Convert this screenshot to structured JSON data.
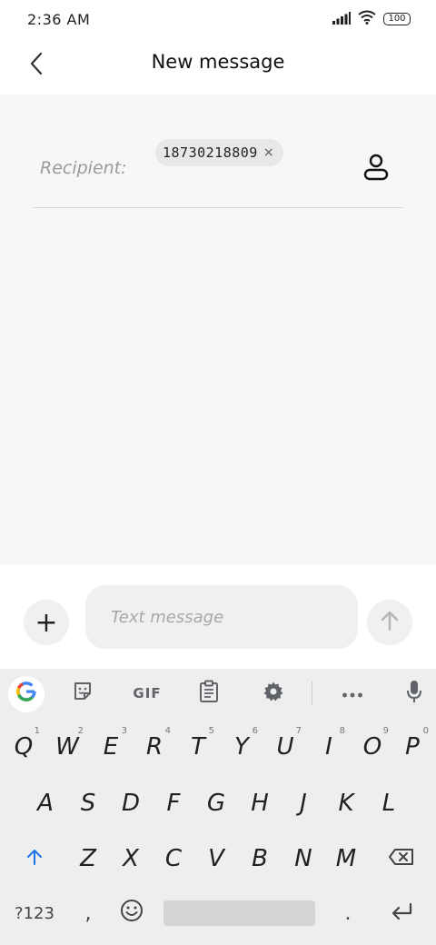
{
  "status_bar": {
    "time": "2:36 AM",
    "battery": "100"
  },
  "header": {
    "title": "New message"
  },
  "recipient": {
    "label": "Recipient:",
    "chip_text": "18730218809",
    "chip_remove": "×"
  },
  "composer": {
    "add_symbol": "+",
    "placeholder": "Text message"
  },
  "keyboard": {
    "toolbar": {
      "google_label": "G",
      "gif_label": "GIF"
    },
    "row1": [
      {
        "key": "Q",
        "hint": "1"
      },
      {
        "key": "W",
        "hint": "2"
      },
      {
        "key": "E",
        "hint": "3"
      },
      {
        "key": "R",
        "hint": "4"
      },
      {
        "key": "T",
        "hint": "5"
      },
      {
        "key": "Y",
        "hint": "6"
      },
      {
        "key": "U",
        "hint": "7"
      },
      {
        "key": "I",
        "hint": "8"
      },
      {
        "key": "O",
        "hint": "9"
      },
      {
        "key": "P",
        "hint": "0"
      }
    ],
    "row2": [
      "A",
      "S",
      "D",
      "F",
      "G",
      "H",
      "J",
      "K",
      "L"
    ],
    "row3": [
      "Z",
      "X",
      "C",
      "V",
      "B",
      "N",
      "M"
    ],
    "row4": {
      "symbols": "?123",
      "comma": ",",
      "period": "."
    }
  },
  "icons": {
    "back": "chevron-left-icon",
    "contact": "person-icon",
    "send": "arrow-up-icon",
    "sticker": "sticker-icon",
    "clipboard": "clipboard-icon",
    "settings": "gear-icon",
    "more": "more-horizontal-icon",
    "mic": "microphone-icon",
    "shift": "shift-icon",
    "backspace": "backspace-icon",
    "emoji": "emoji-icon",
    "enter": "enter-icon"
  },
  "colors": {
    "shift_accent": "#1a73e8",
    "content_bg": "#f7f7f7",
    "keyboard_bg": "#eeeeee"
  }
}
